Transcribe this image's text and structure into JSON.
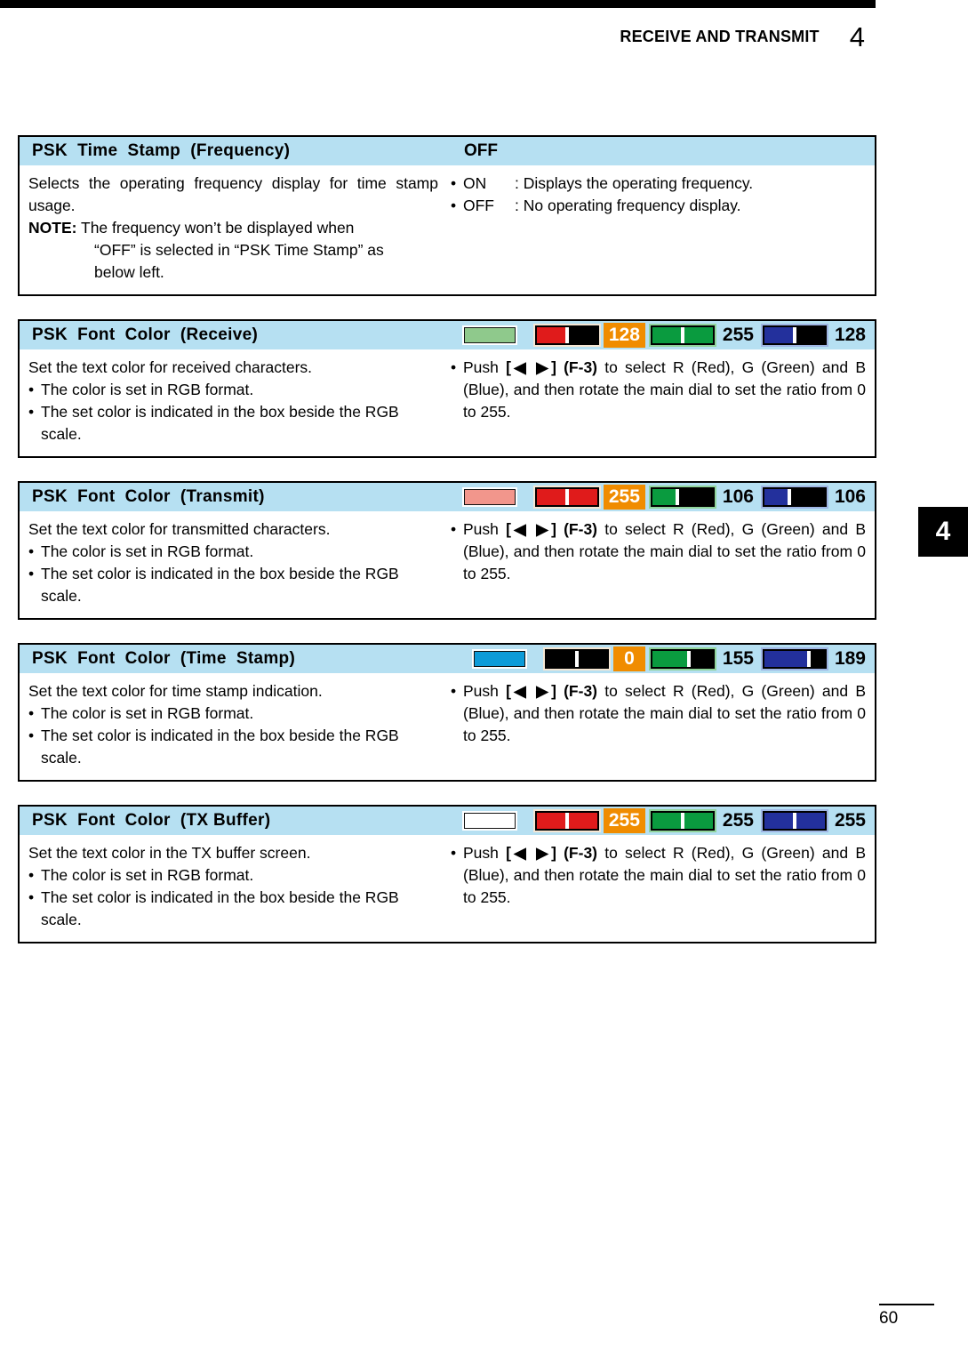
{
  "header": {
    "title": "RECEIVE AND TRANSMIT",
    "chapter": "4"
  },
  "side_tab": {
    "label": "4"
  },
  "footer": {
    "page_number": "60"
  },
  "sections": [
    {
      "name": "psk-time-stamp-frequency",
      "title": "PSK  Time  Stamp  (Frequency)",
      "head_value": "OFF",
      "has_rgb": false,
      "left": {
        "p1": "Selects the operating frequency display for time stamp usage.",
        "note_label": "NOTE:",
        "note_text": " The frequency won’t be displayed when",
        "note_line2": "“OFF” is selected in “PSK Time Stamp” as",
        "note_line3": "below left."
      },
      "right": {
        "opt1_key": "ON",
        "opt1_val": ": Displays the operating frequency.",
        "opt2_key": "OFF",
        "opt2_val": ": No operating frequency display."
      }
    },
    {
      "name": "psk-font-color-receive",
      "title": "PSK  Font  Color  (Receive)",
      "has_rgb": true,
      "swatch_color": "#8fc98c",
      "rgb": {
        "r": 128,
        "g": 255,
        "b": 128,
        "active": "r"
      },
      "left": {
        "p1": "Set the text color for received characters.",
        "b1": "The color is set in RGB format.",
        "b2": "The set color is indicated in the box beside the RGB scale."
      },
      "right": {
        "push": "Push ",
        "keys": "[◀ ▶] (F-3)",
        "rest": " to select R (Red), G (Green) and B (Blue), and then rotate the main dial to set the ratio from 0 to 255."
      }
    },
    {
      "name": "psk-font-color-transmit",
      "title": "PSK  Font  Color  (Transmit)",
      "has_rgb": true,
      "swatch_color": "#f2968c",
      "rgb": {
        "r": 255,
        "g": 106,
        "b": 106,
        "active": "r"
      },
      "left": {
        "p1": "Set the text color for transmitted characters.",
        "b1": "The color is set in RGB format.",
        "b2": "The set color is indicated in the box beside the RGB scale."
      },
      "right": {
        "push": "Push ",
        "keys": "[◀ ▶] (F-3)",
        "rest": " to select R (Red), G (Green) and B (Blue), and then rotate the main dial to set the ratio from 0 to 255."
      }
    },
    {
      "name": "psk-font-color-time-stamp",
      "title": "PSK  Font  Color  (Time  Stamp)",
      "has_rgb": true,
      "swatch_color": "#0d9bd8",
      "rgb": {
        "r": 0,
        "g": 155,
        "b": 189,
        "active": "r"
      },
      "left": {
        "p1": "Set the text color for time stamp indication.",
        "b1": "The color is set in RGB format.",
        "b2": "The set color is indicated in the box beside the RGB scale."
      },
      "right": {
        "push": "Push ",
        "keys": "[◀ ▶] (F-3)",
        "rest": " to select R (Red), G (Green) and B (Blue), and then rotate the main dial to set the ratio from 0 to 255."
      }
    },
    {
      "name": "psk-font-color-tx-buffer",
      "title": "PSK  Font  Color  (TX Buffer)",
      "has_rgb": true,
      "swatch_color": "#ffffff",
      "rgb": {
        "r": 255,
        "g": 255,
        "b": 255,
        "active": "r"
      },
      "left": {
        "p1": "Set the text color in the TX buffer screen.",
        "b1": "The color is set in RGB format.",
        "b2": "The set color is indicated in the box beside the RGB scale."
      },
      "right": {
        "push": "Push ",
        "keys": "[◀ ▶] (F-3)",
        "rest": " to select R (Red), G (Green) and B (Blue), and then rotate the main dial to set the ratio from 0 to 255."
      }
    }
  ],
  "colors": {
    "header_band": "#b6e0f2",
    "active_value_bg": "#f08c00",
    "red_channel": "#e01b1b",
    "green_channel": "#0a9b3f",
    "blue_channel": "#23309c",
    "channel_track": "#000000"
  }
}
